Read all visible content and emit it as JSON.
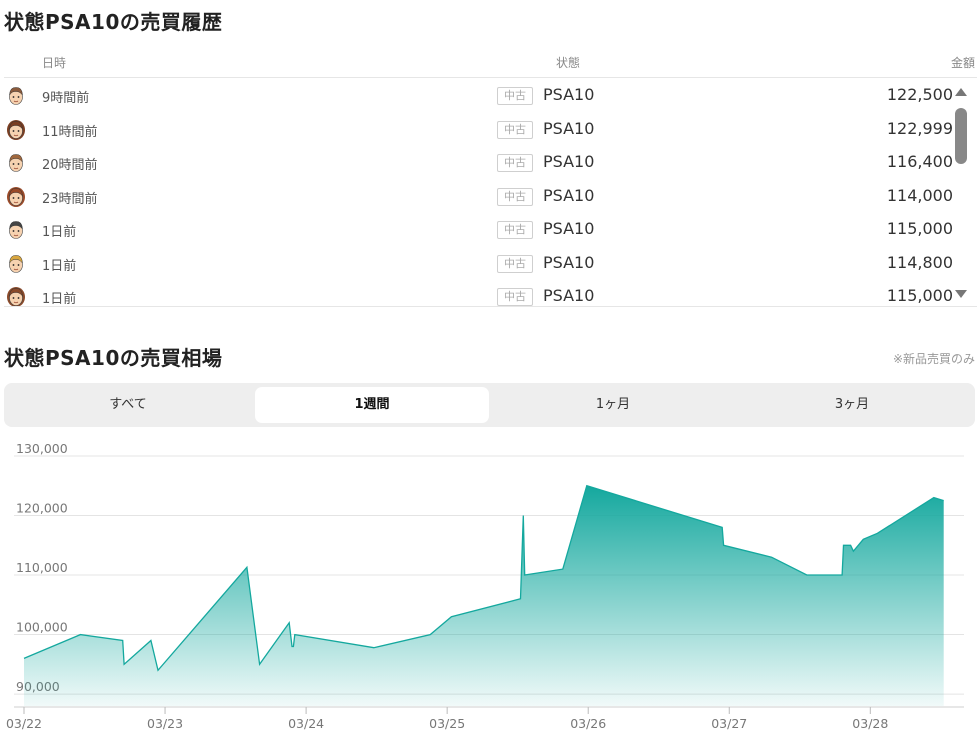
{
  "history": {
    "title": "状態PSA10の売買履歴",
    "columns": {
      "date": "日時",
      "condition": "状態",
      "price": "金額"
    },
    "rows": [
      {
        "time": "9時間前",
        "badge": "中古",
        "condition": "PSA10",
        "price": "122,500",
        "avatar_icon": "avatar-male-icon",
        "avatar_color": "#8a5a3c"
      },
      {
        "time": "11時間前",
        "badge": "中古",
        "condition": "PSA10",
        "price": "122,999",
        "avatar_icon": "avatar-female-icon",
        "avatar_color": "#7a3e22"
      },
      {
        "time": "20時間前",
        "badge": "中古",
        "condition": "PSA10",
        "price": "116,400",
        "avatar_icon": "avatar-male-icon",
        "avatar_color": "#a0683e"
      },
      {
        "time": "23時間前",
        "badge": "中古",
        "condition": "PSA10",
        "price": "114,000",
        "avatar_icon": "avatar-female-icon",
        "avatar_color": "#9a4a28"
      },
      {
        "time": "1日前",
        "badge": "中古",
        "condition": "PSA10",
        "price": "115,000",
        "avatar_icon": "avatar-male-icon",
        "avatar_color": "#444444"
      },
      {
        "time": "1日前",
        "badge": "中古",
        "condition": "PSA10",
        "price": "114,800",
        "avatar_icon": "avatar-male-icon",
        "avatar_color": "#d8a640"
      },
      {
        "time": "1日前",
        "badge": "中古",
        "condition": "PSA10",
        "price": "115,000",
        "avatar_icon": "avatar-female-icon",
        "avatar_color": "#8a4a2a"
      }
    ]
  },
  "market": {
    "title": "状態PSA10の売買相場",
    "note": "※新品売買のみ",
    "tabs": [
      {
        "label": "すべて",
        "active": false
      },
      {
        "label": "1週間",
        "active": true
      },
      {
        "label": "1ヶ月",
        "active": false
      },
      {
        "label": "3ヶ月",
        "active": false
      }
    ]
  },
  "colors": {
    "accent": "#14a89e",
    "grid": "#e4e4e4",
    "axis_text": "#777777"
  },
  "chart_data": {
    "type": "area",
    "title": "",
    "xlabel": "",
    "ylabel": "",
    "ylim": [
      88000,
      131000
    ],
    "xlim": [
      0,
      6.65
    ],
    "yticks": [
      90000,
      100000,
      110000,
      120000,
      130000
    ],
    "ytick_labels": [
      "90,000",
      "100,000",
      "110,000",
      "120,000",
      "130,000"
    ],
    "xticks": [
      0,
      1,
      2,
      3,
      4,
      5,
      6
    ],
    "xtick_labels": [
      "03/22",
      "03/23",
      "03/24",
      "03/25",
      "03/26",
      "03/27",
      "03/28"
    ],
    "grid": true,
    "series": [
      {
        "x": [
          0.0,
          0.4,
          0.7,
          0.71,
          0.9,
          0.95,
          1.58,
          1.67,
          1.88,
          1.9,
          1.91,
          1.92,
          2.48,
          2.88,
          3.03,
          3.52,
          3.54,
          3.55,
          3.82,
          3.99,
          4.95,
          4.96,
          5.3,
          5.55,
          5.8,
          5.81,
          5.86,
          5.88,
          5.95,
          6.05,
          6.45,
          6.52
        ],
        "values": [
          96000,
          100000,
          99000,
          95000,
          99000,
          94000,
          111300,
          95000,
          102000,
          98000,
          98000,
          100000,
          97800,
          100000,
          103000,
          106000,
          120000,
          110000,
          111000,
          125000,
          118000,
          115000,
          113000,
          110000,
          110000,
          115000,
          115000,
          114000,
          116000,
          117000,
          123000,
          122500
        ]
      }
    ]
  }
}
